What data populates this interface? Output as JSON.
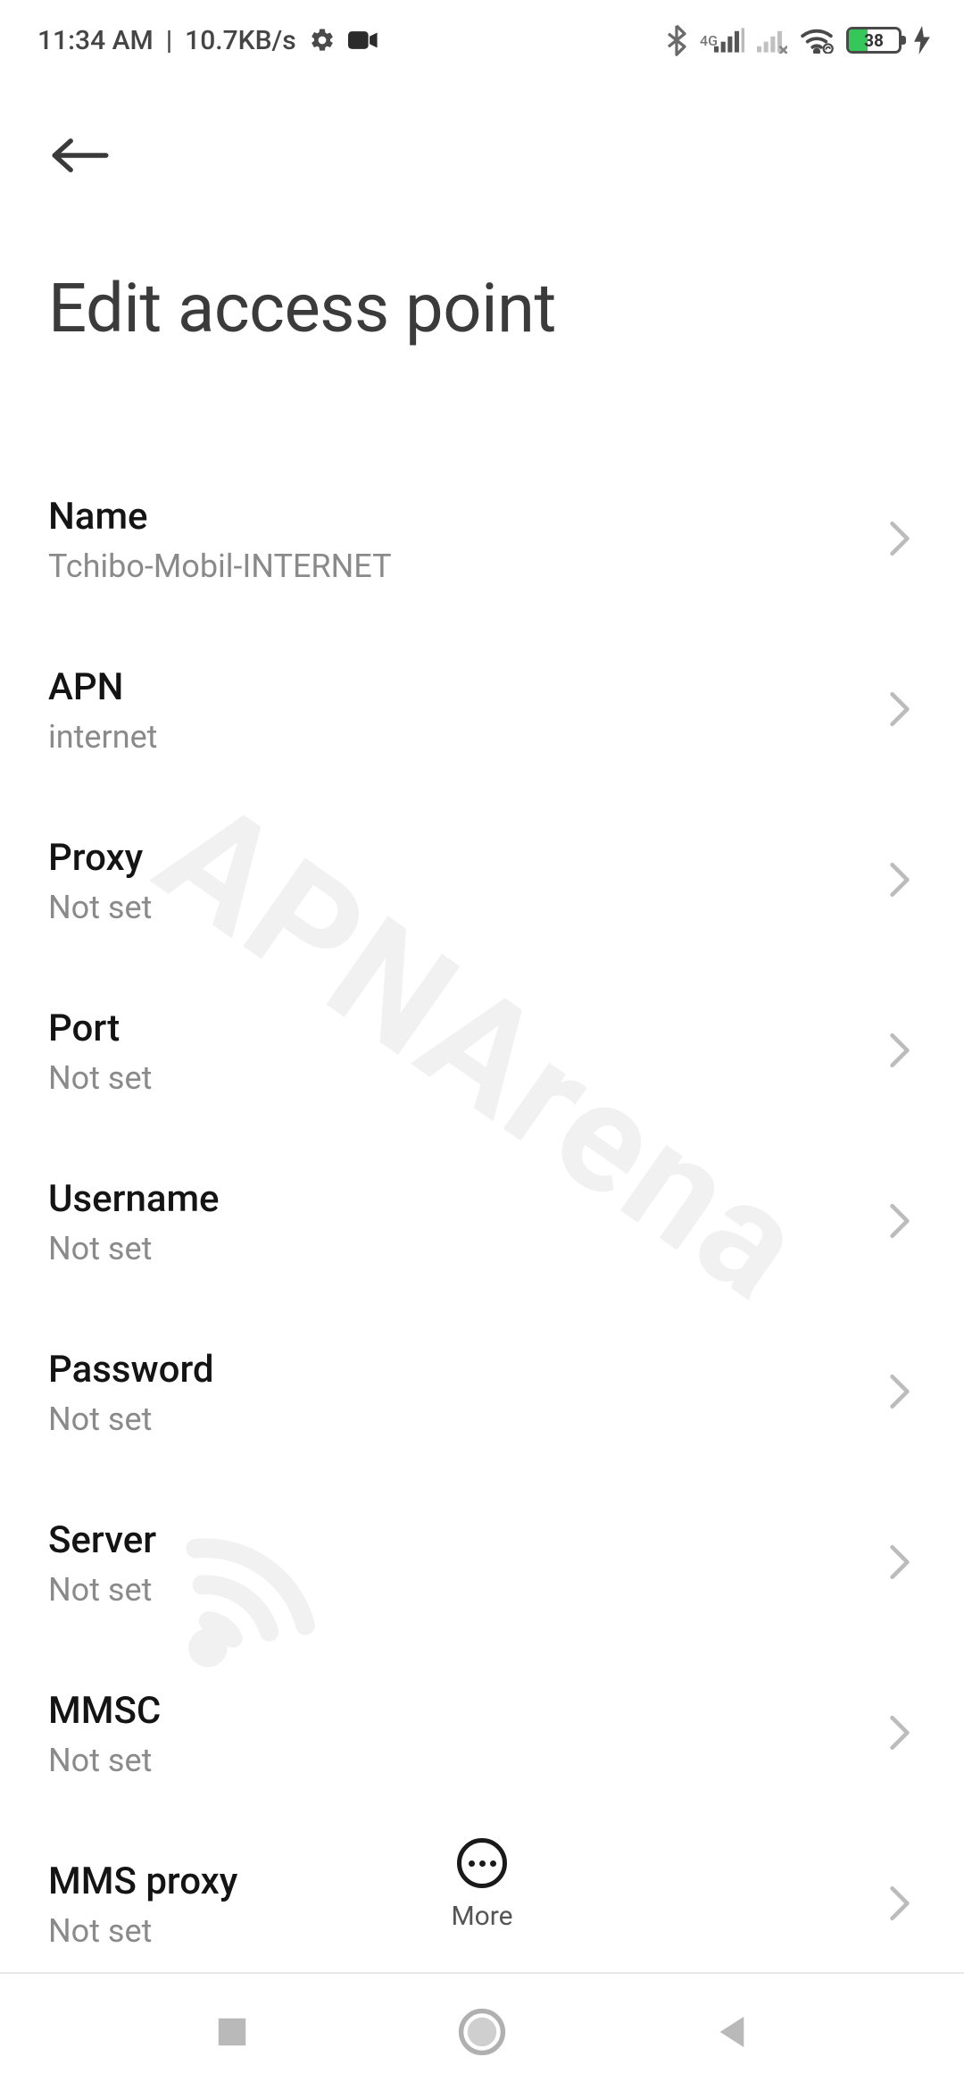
{
  "status_bar": {
    "time": "11:34 AM",
    "speed": "10.7KB/s",
    "network_type": "4G",
    "battery": "38"
  },
  "page_title": "Edit access point",
  "fields": [
    {
      "label": "Name",
      "value": "Tchibo-Mobil-INTERNET"
    },
    {
      "label": "APN",
      "value": "internet"
    },
    {
      "label": "Proxy",
      "value": "Not set"
    },
    {
      "label": "Port",
      "value": "Not set"
    },
    {
      "label": "Username",
      "value": "Not set"
    },
    {
      "label": "Password",
      "value": "Not set"
    },
    {
      "label": "Server",
      "value": "Not set"
    },
    {
      "label": "MMSC",
      "value": "Not set"
    },
    {
      "label": "MMS proxy",
      "value": "Not set"
    }
  ],
  "more_label": "More",
  "watermark": "APNArena"
}
